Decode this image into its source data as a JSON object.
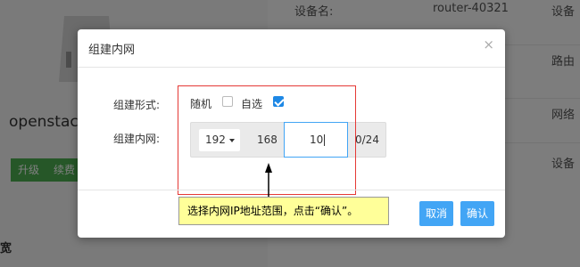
{
  "background": {
    "device_name": "openstack",
    "buttons": [
      "升级",
      "续费"
    ],
    "info": {
      "device_label": "设备名:",
      "device_value": "router-40321",
      "right_col_1": "设备",
      "right_col_2": "路由",
      "right_col_3": "网络",
      "right_col_4": "设备"
    },
    "bottom_label": "宽"
  },
  "modal": {
    "title": "组建内网",
    "close_icon": "×",
    "mode_label": "组建形式:",
    "option_random": "随机",
    "option_custom": "自选",
    "option_random_checked": false,
    "option_custom_checked": true,
    "network_label": "组建内网:",
    "ip": {
      "octet1": "192",
      "octet2": "168",
      "octet3": "10",
      "suffix": "0/24"
    },
    "cancel_label": "取消",
    "confirm_label": "确认"
  },
  "annotation": {
    "tooltip": "选择内网IP地址范围，点击“确认”。"
  },
  "colors": {
    "primary": "#42a5f5",
    "annotation_border": "#e53935",
    "tooltip_bg": "#ffff99",
    "bg_button": "#4caf50"
  }
}
